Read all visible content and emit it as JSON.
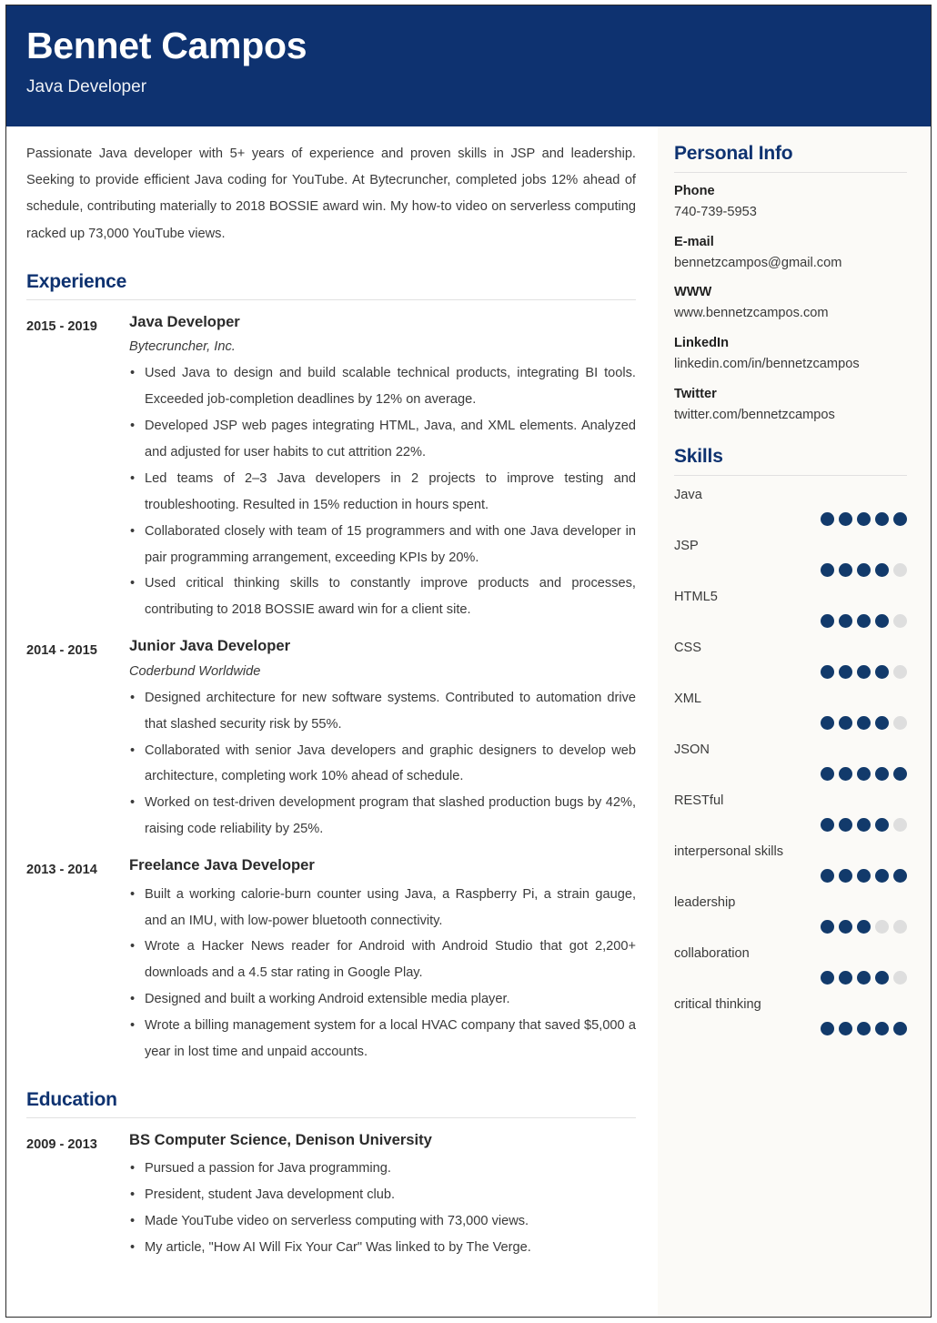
{
  "header": {
    "name": "Bennet Campos",
    "title": "Java Developer"
  },
  "summary": "Passionate Java developer with 5+ years of experience and proven skills in JSP and leadership. Seeking to provide efficient Java coding for YouTube. At Bytecruncher, completed jobs 12% ahead of schedule, contributing materially to 2018 BOSSIE award win. My how-to video on serverless computing racked up 73,000 YouTube views.",
  "sections": {
    "experience_heading": "Experience",
    "education_heading": "Education"
  },
  "experience": [
    {
      "dates": "2015 - 2019",
      "role": "Java Developer",
      "org": "Bytecruncher, Inc.",
      "bullets": [
        "Used Java to design and build scalable technical products, integrating BI tools. Exceeded job-completion deadlines by 12% on average.",
        "Developed JSP web pages integrating HTML, Java, and XML elements. Analyzed and adjusted for user habits to cut attrition 22%.",
        "Led teams of 2–3 Java developers in 2 projects to improve testing and troubleshooting. Resulted in 15% reduction in hours spent.",
        "Collaborated closely with team of 15 programmers and with one Java developer in pair programming arrangement, exceeding KPIs by 20%.",
        "Used critical thinking skills to constantly improve products and processes, contributing to 2018 BOSSIE award win for a client site."
      ]
    },
    {
      "dates": "2014 - 2015",
      "role": "Junior Java Developer",
      "org": "Coderbund Worldwide",
      "bullets": [
        "Designed architecture for new software systems. Contributed to automation drive that slashed security risk by 55%.",
        "Collaborated with senior Java developers and graphic designers to develop web architecture, completing work 10% ahead of schedule.",
        "Worked on test-driven development program that slashed production bugs by 42%, raising code reliability by 25%."
      ]
    },
    {
      "dates": "2013 - 2014",
      "role": "Freelance Java Developer",
      "org": "",
      "bullets": [
        "Built a working calorie-burn counter using Java, a Raspberry Pi, a strain gauge, and an IMU, with low-power bluetooth connectivity.",
        "Wrote a Hacker News reader for Android with Android Studio that got 2,200+ downloads and a 4.5 star rating in Google Play.",
        "Designed and built a working Android extensible media player.",
        "Wrote a billing management system for a local HVAC company that saved $5,000 a year in lost time and unpaid accounts."
      ]
    }
  ],
  "education": [
    {
      "dates": "2009 - 2013",
      "role": "BS Computer Science, Denison University",
      "org": "",
      "bullets": [
        "Pursued a passion for Java programming.",
        "President, student Java development club.",
        "Made YouTube video on serverless computing with 73,000 views.",
        "My article, \"How AI Will Fix Your Car\" Was linked to by The Verge."
      ]
    }
  ],
  "personal_info": {
    "heading": "Personal Info",
    "items": [
      {
        "label": "Phone",
        "value": "740-739-5953"
      },
      {
        "label": "E-mail",
        "value": "bennetzcampos@gmail.com"
      },
      {
        "label": "WWW",
        "value": "www.bennetzcampos.com"
      },
      {
        "label": "LinkedIn",
        "value": "linkedin.com/in/bennetzcampos"
      },
      {
        "label": "Twitter",
        "value": "twitter.com/bennetzcampos"
      }
    ]
  },
  "skills": {
    "heading": "Skills",
    "max_rating": 5,
    "items": [
      {
        "name": "Java",
        "rating": 5
      },
      {
        "name": "JSP",
        "rating": 4
      },
      {
        "name": "HTML5",
        "rating": 4
      },
      {
        "name": "CSS",
        "rating": 4
      },
      {
        "name": "XML",
        "rating": 4
      },
      {
        "name": "JSON",
        "rating": 5
      },
      {
        "name": "RESTful",
        "rating": 4
      },
      {
        "name": "interpersonal skills",
        "rating": 5
      },
      {
        "name": "leadership",
        "rating": 3
      },
      {
        "name": "collaboration",
        "rating": 4
      },
      {
        "name": "critical thinking",
        "rating": 5
      }
    ]
  },
  "colors": {
    "header_background": "#0e3270",
    "heading_accent": "#0e3270",
    "dot_filled": "#123a6b",
    "dot_empty": "#dedede",
    "sidebar_background": "#fbfaf7"
  }
}
